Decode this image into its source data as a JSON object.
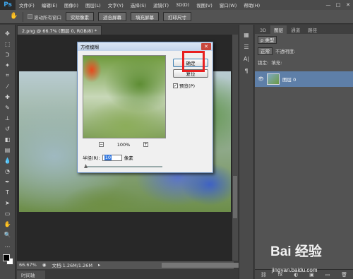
{
  "app": {
    "logo": "Ps"
  },
  "menu": [
    "文件(F)",
    "编辑(E)",
    "图像(I)",
    "图层(L)",
    "文字(Y)",
    "选择(S)",
    "滤镜(T)",
    "3D(D)",
    "视图(V)",
    "窗口(W)",
    "帮助(H)"
  ],
  "window_controls": [
    "—",
    "□",
    "✕"
  ],
  "options_bar": {
    "scroll_all_label": "滚动所有窗口",
    "buttons": [
      "实际像素",
      "适合屏幕",
      "填充屏幕",
      "打印尺寸"
    ]
  },
  "document": {
    "tab_title": "2.png @ 66.7% (图层 0, RGB/8) *",
    "zoom": "66.67%",
    "doc_info": "文档:1.26M/1.26M",
    "timeline_tab": "时间轴"
  },
  "right_panel": {
    "tabs": [
      "3D",
      "图层",
      "通道",
      "路径"
    ],
    "kind_select": "ρ 类型",
    "blend_mode": "正常",
    "opacity_label": "不透明度:",
    "lock_label": "锁定:",
    "fill_label": "填充:",
    "layer_name": "图层 0",
    "bottom_icons": [
      "⛓",
      "fx",
      "◐",
      "▣",
      "▭",
      "🗑"
    ]
  },
  "dialog": {
    "title": "方框模糊",
    "ok_label": "确定",
    "reset_label": "复位",
    "preview_label": "预览(P)",
    "preview_checked": true,
    "zoom_value": "100%",
    "radius_label": "半径(R):",
    "radius_value": "10",
    "radius_unit": "像素"
  },
  "watermark": {
    "brand": "Bai 经验",
    "url": "jingyan.baidu.com"
  }
}
